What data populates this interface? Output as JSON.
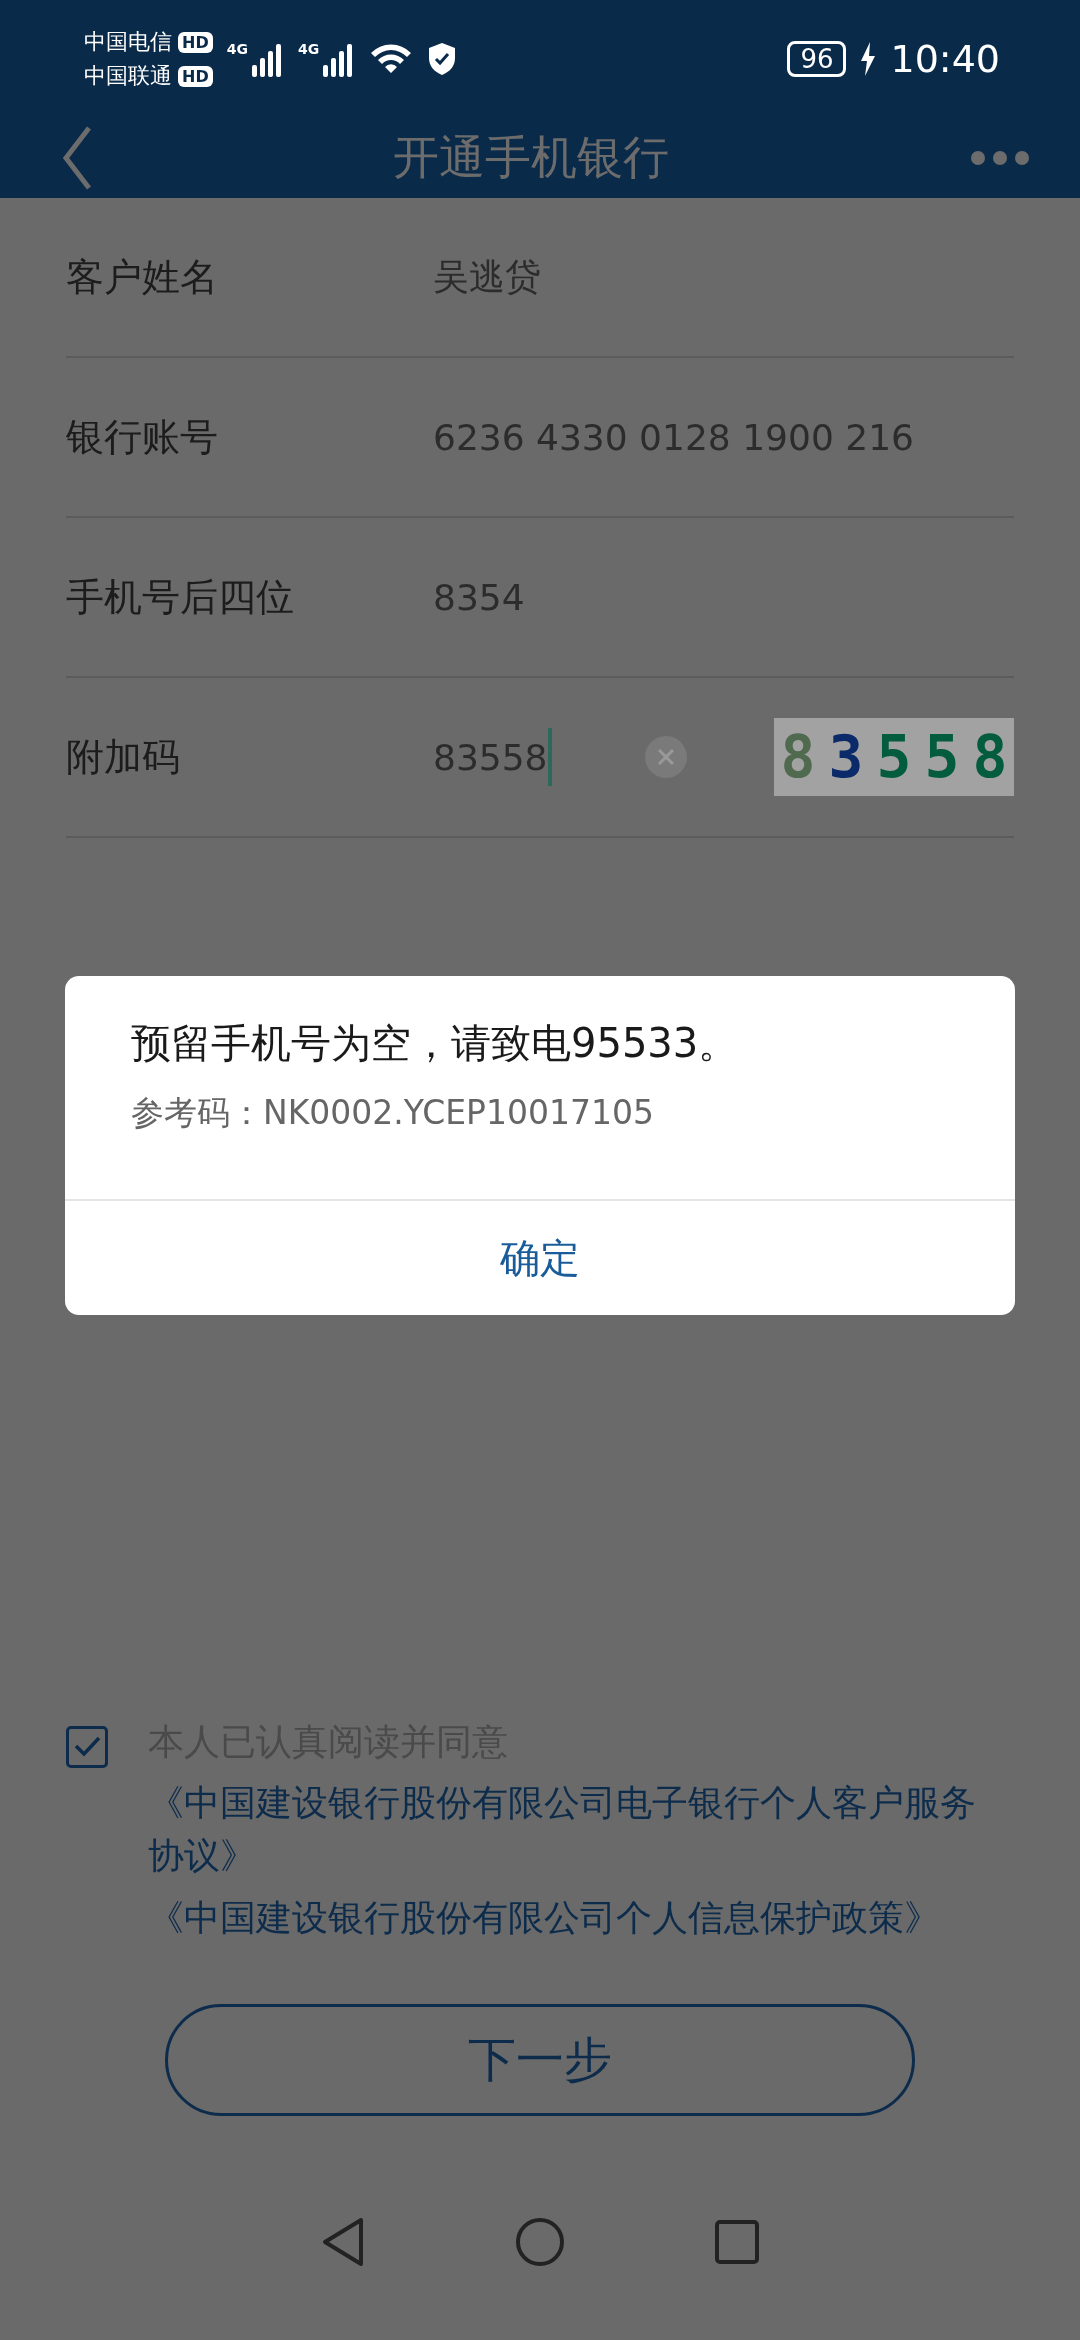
{
  "status_bar": {
    "carriers": [
      {
        "name": "中国电信",
        "badge": "HD"
      },
      {
        "name": "中国联通",
        "badge": "HD"
      }
    ],
    "networks": [
      "4G",
      "4G"
    ],
    "battery": "96",
    "time": "10:40"
  },
  "header": {
    "title": "开通手机银行"
  },
  "form": {
    "rows": [
      {
        "label": "客户姓名",
        "value": "吴逃贷"
      },
      {
        "label": "银行账号",
        "value": "6236 4330 0128 1900 216"
      },
      {
        "label": "手机号后四位",
        "value": "8354"
      }
    ],
    "captcha_row": {
      "label": "附加码",
      "value": "83558",
      "captcha": [
        {
          "char": "8",
          "color": "#4f6a4f"
        },
        {
          "char": "3",
          "color": "#0b2a6a"
        },
        {
          "char": "5",
          "color": "#045c3e"
        },
        {
          "char": "5",
          "color": "#045c3e"
        },
        {
          "char": "8",
          "color": "#045c3e"
        }
      ]
    }
  },
  "dialog": {
    "message": "预留手机号为空，请致电95533。",
    "reference": "参考码：NK0002.YCEP10017105",
    "button": "确定"
  },
  "agreement": {
    "checked": true,
    "text": "本人已认真阅读并同意",
    "links": [
      "《中国建设银行股份有限公司电子银行个人客户服务协议》",
      "《中国建设银行股份有限公司个人信息保护政策》"
    ]
  },
  "next_button": "下一步"
}
